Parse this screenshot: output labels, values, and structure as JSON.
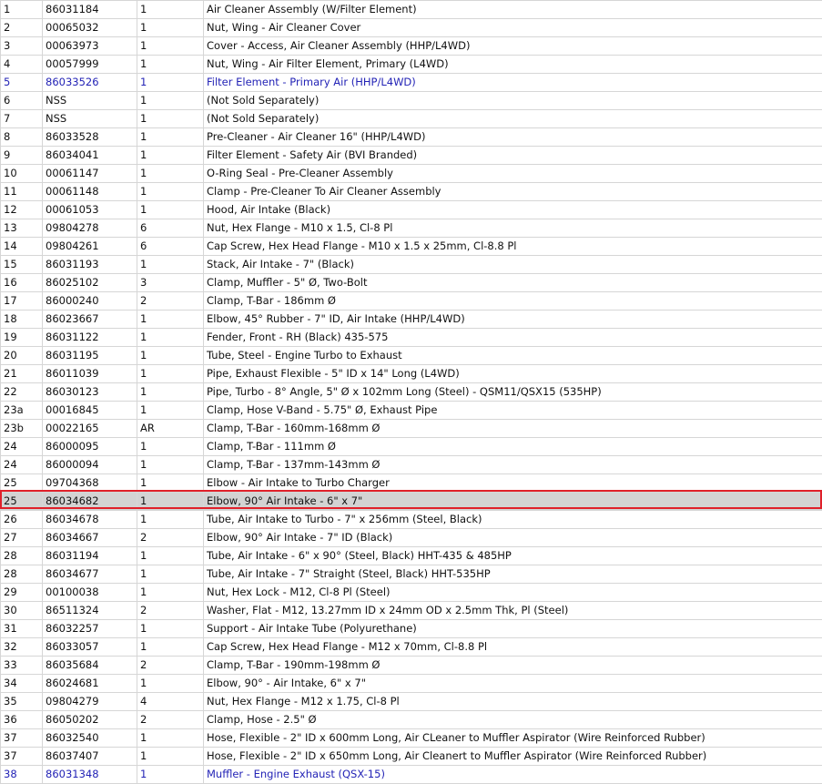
{
  "parts_table": {
    "rows": [
      {
        "ref": "1",
        "part": "86031184",
        "qty": "1",
        "desc": "Air Cleaner Assembly (W/Filter Element)"
      },
      {
        "ref": "2",
        "part": "00065032",
        "qty": "1",
        "desc": "Nut, Wing - Air Cleaner Cover"
      },
      {
        "ref": "3",
        "part": "00063973",
        "qty": "1",
        "desc": "Cover - Access, Air Cleaner Assembly (HHP/L4WD)"
      },
      {
        "ref": "4",
        "part": "00057999",
        "qty": "1",
        "desc": "Nut, Wing - Air Filter Element, Primary (L4WD)"
      },
      {
        "ref": "5",
        "part": "86033526",
        "qty": "1",
        "desc": "Filter Element - Primary Air (HHP/L4WD)",
        "link": true
      },
      {
        "ref": "6",
        "part": "NSS",
        "qty": "1",
        "desc": "(Not Sold Separately)"
      },
      {
        "ref": "7",
        "part": "NSS",
        "qty": "1",
        "desc": "(Not Sold Separately)"
      },
      {
        "ref": "8",
        "part": "86033528",
        "qty": "1",
        "desc": "Pre-Cleaner - Air Cleaner 16\" (HHP/L4WD)"
      },
      {
        "ref": "9",
        "part": "86034041",
        "qty": "1",
        "desc": "Filter Element - Safety Air (BVI Branded)"
      },
      {
        "ref": "10",
        "part": "00061147",
        "qty": "1",
        "desc": "O-Ring Seal - Pre-Cleaner Assembly"
      },
      {
        "ref": "11",
        "part": "00061148",
        "qty": "1",
        "desc": "Clamp - Pre-Cleaner To Air Cleaner Assembly"
      },
      {
        "ref": "12",
        "part": "00061053",
        "qty": "1",
        "desc": "Hood, Air Intake (Black)"
      },
      {
        "ref": "13",
        "part": "09804278",
        "qty": "6",
        "desc": "Nut, Hex Flange - M10 x 1.5, Cl-8 Pl"
      },
      {
        "ref": "14",
        "part": "09804261",
        "qty": "6",
        "desc": "Cap Screw, Hex Head Flange - M10 x 1.5 x 25mm, Cl-8.8 Pl"
      },
      {
        "ref": "15",
        "part": "86031193",
        "qty": "1",
        "desc": "Stack, Air Intake - 7\" (Black)"
      },
      {
        "ref": "16",
        "part": "86025102",
        "qty": "3",
        "desc": "Clamp, Muffler - 5\" Ø, Two-Bolt"
      },
      {
        "ref": "17",
        "part": "86000240",
        "qty": "2",
        "desc": "Clamp, T-Bar - 186mm Ø"
      },
      {
        "ref": "18",
        "part": "86023667",
        "qty": "1",
        "desc": "Elbow, 45° Rubber - 7\" ID, Air Intake (HHP/L4WD)"
      },
      {
        "ref": "19",
        "part": "86031122",
        "qty": "1",
        "desc": "Fender, Front - RH (Black) 435-575"
      },
      {
        "ref": "20",
        "part": "86031195",
        "qty": "1",
        "desc": "Tube, Steel - Engine Turbo to Exhaust"
      },
      {
        "ref": "21",
        "part": "86011039",
        "qty": "1",
        "desc": "Pipe, Exhaust Flexible - 5\" ID x 14\" Long (L4WD)"
      },
      {
        "ref": "22",
        "part": "86030123",
        "qty": "1",
        "desc": "Pipe, Turbo - 8° Angle, 5\" Ø x 102mm Long (Steel) - QSM11/QSX15 (535HP)"
      },
      {
        "ref": "23a",
        "part": "00016845",
        "qty": "1",
        "desc": "Clamp, Hose V-Band - 5.75\" Ø, Exhaust Pipe"
      },
      {
        "ref": "23b",
        "part": "00022165",
        "qty": "AR",
        "desc": "Clamp, T-Bar - 160mm-168mm Ø"
      },
      {
        "ref": "24",
        "part": "86000095",
        "qty": "1",
        "desc": "Clamp, T-Bar - 111mm Ø"
      },
      {
        "ref": "24",
        "part": "86000094",
        "qty": "1",
        "desc": "Clamp, T-Bar - 137mm-143mm Ø"
      },
      {
        "ref": "25",
        "part": "09704368",
        "qty": "1",
        "desc": "Elbow - Air Intake to Turbo Charger"
      },
      {
        "ref": "25",
        "part": "86034682",
        "qty": "1",
        "desc": "Elbow, 90° Air Intake - 6\" x 7\"",
        "selected": true
      },
      {
        "ref": "26",
        "part": "86034678",
        "qty": "1",
        "desc": "Tube, Air Intake to Turbo - 7\" x 256mm (Steel, Black)"
      },
      {
        "ref": "27",
        "part": "86034667",
        "qty": "2",
        "desc": "Elbow, 90° Air Intake - 7\" ID (Black)"
      },
      {
        "ref": "28",
        "part": "86031194",
        "qty": "1",
        "desc": "Tube, Air Intake - 6\" x 90° (Steel, Black) HHT-435 & 485HP"
      },
      {
        "ref": "28",
        "part": "86034677",
        "qty": "1",
        "desc": "Tube, Air Intake - 7\" Straight (Steel, Black) HHT-535HP"
      },
      {
        "ref": "29",
        "part": "00100038",
        "qty": "1",
        "desc": "Nut, Hex Lock - M12, Cl-8 Pl (Steel)"
      },
      {
        "ref": "30",
        "part": "86511324",
        "qty": "2",
        "desc": "Washer, Flat - M12, 13.27mm ID x 24mm OD x 2.5mm Thk, Pl (Steel)"
      },
      {
        "ref": "31",
        "part": "86032257",
        "qty": "1",
        "desc": "Support - Air Intake Tube (Polyurethane)"
      },
      {
        "ref": "32",
        "part": "86033057",
        "qty": "1",
        "desc": "Cap Screw, Hex Head Flange - M12 x 70mm, Cl-8.8 Pl"
      },
      {
        "ref": "33",
        "part": "86035684",
        "qty": "2",
        "desc": "Clamp, T-Bar - 190mm-198mm Ø"
      },
      {
        "ref": "34",
        "part": "86024681",
        "qty": "1",
        "desc": "Elbow, 90° - Air Intake, 6\" x 7\""
      },
      {
        "ref": "35",
        "part": "09804279",
        "qty": "4",
        "desc": "Nut, Hex Flange - M12 x 1.75, Cl-8 Pl"
      },
      {
        "ref": "36",
        "part": "86050202",
        "qty": "2",
        "desc": "Clamp, Hose - 2.5\" Ø"
      },
      {
        "ref": "37",
        "part": "86032540",
        "qty": "1",
        "desc": "Hose, Flexible - 2\" ID x 600mm Long, Air CLeaner to Muffler Aspirator (Wire Reinforced Rubber)"
      },
      {
        "ref": "37",
        "part": "86037407",
        "qty": "1",
        "desc": "Hose, Flexible - 2\" ID x 650mm Long, Air Cleanert to Muffler Aspirator (Wire Reinforced Rubber)"
      },
      {
        "ref": "38",
        "part": "86031348",
        "qty": "1",
        "desc": "Muffler - Engine Exhaust (QSX-15)",
        "link": true
      }
    ]
  },
  "colors": {
    "link_text": "#2323b6",
    "selected_row_bg": "#d3d3d3",
    "selection_outline": "#e0202a",
    "grid_line": "#d6d6d6"
  }
}
